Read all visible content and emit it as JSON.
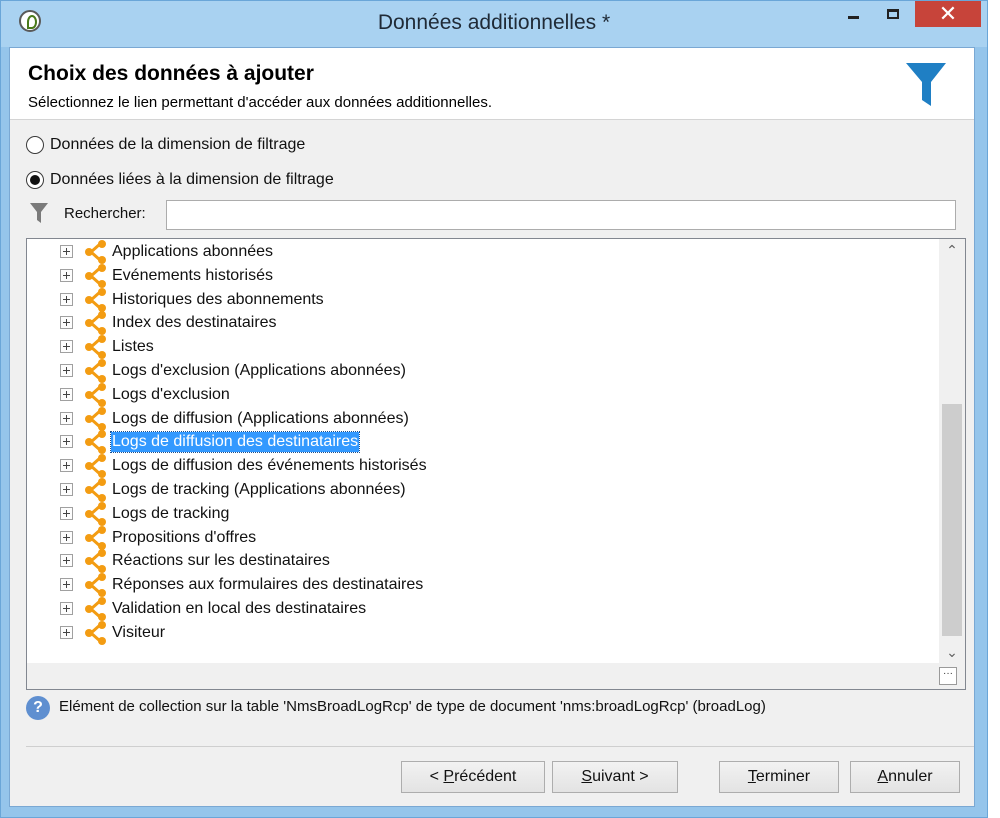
{
  "window": {
    "title": "Données additionnelles *",
    "close_glyph": "✕"
  },
  "header": {
    "title": "Choix des données à ajouter",
    "subtitle": "Sélectionnez le lien permettant d'accéder aux données additionnelles.",
    "icon": "funnel-icon",
    "icon_color": "#1f7fc4"
  },
  "options": [
    {
      "label": "Données de la dimension de filtrage",
      "checked": false
    },
    {
      "label": "Données liées à la dimension de filtrage",
      "checked": true
    }
  ],
  "search": {
    "label": "Rechercher:",
    "value": ""
  },
  "tree": {
    "selected_index": 8,
    "link_icon_color": "#f39c12",
    "items": [
      "Applications abonnées",
      "Evénements historisés",
      "Historiques des abonnements",
      "Index des destinataires",
      "Listes",
      "Logs d'exclusion (Applications abonnées)",
      "Logs d'exclusion",
      "Logs de diffusion (Applications abonnées)",
      "Logs de diffusion des destinataires",
      "Logs de diffusion des événements historisés",
      "Logs de tracking (Applications abonnées)",
      "Logs de tracking",
      "Propositions d'offres",
      "Réactions sur les destinataires",
      "Réponses aux formulaires des destinataires",
      "Validation en local des destinataires",
      "Visiteur"
    ],
    "scroll_up": "⌃",
    "scroll_down": "⌄",
    "ellipsis": "···"
  },
  "info": {
    "icon": "?",
    "text": "Elément de collection sur la table 'NmsBroadLogRcp' de type de document 'nms:broadLogRcp' (broadLog)"
  },
  "buttons": {
    "previous_accel": "P",
    "previous_rest": "récédent",
    "previous_prefix": "< ",
    "next_accel": "S",
    "next_rest": "uivant >",
    "finish_accel": "T",
    "finish_rest": "erminer",
    "cancel_accel": "A",
    "cancel_rest": "nnuler"
  }
}
